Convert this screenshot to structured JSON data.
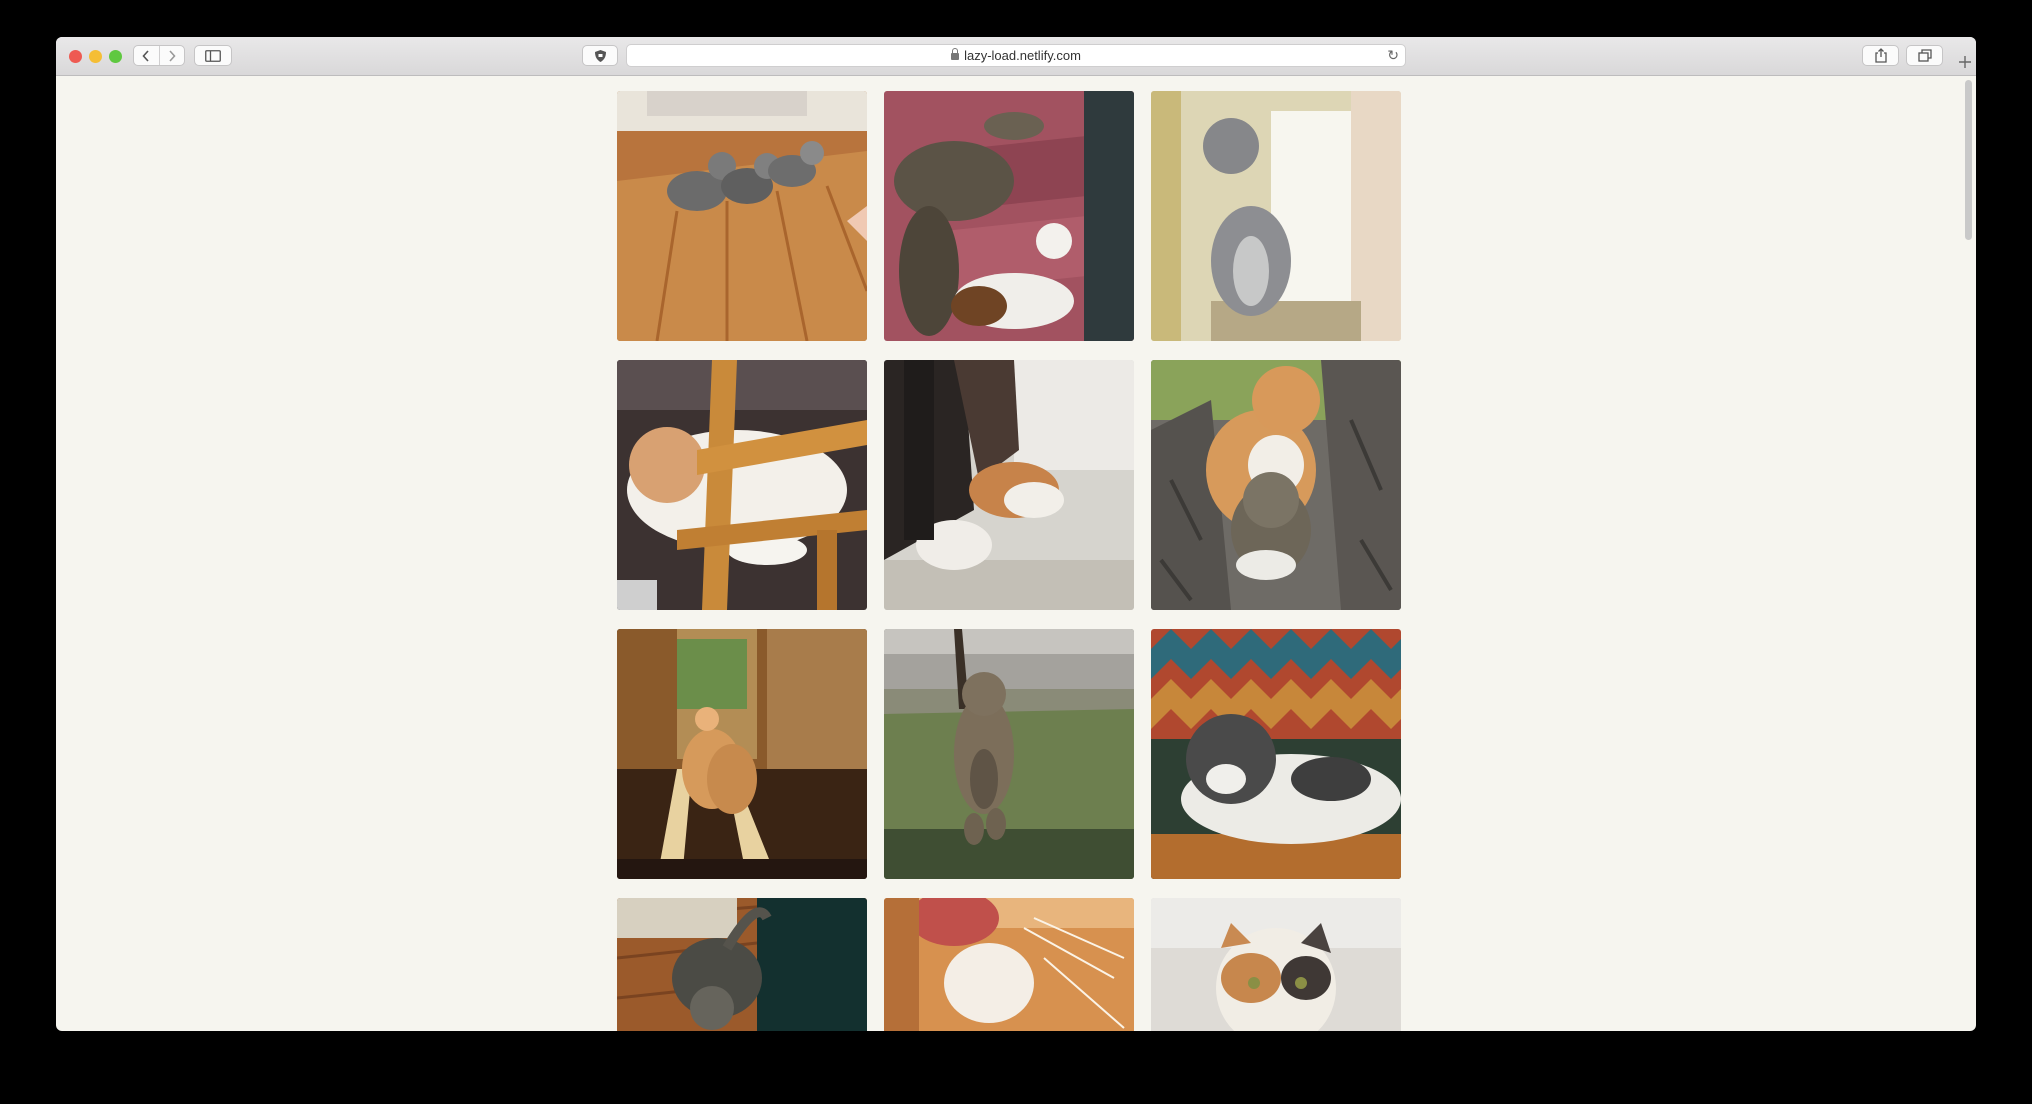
{
  "browser": {
    "url": "lazy-load.netlify.com",
    "back_icon": "chevron-left-icon",
    "forward_icon": "chevron-right-icon",
    "sidebar_icon": "sidebar-icon",
    "shield_icon": "shield-icon",
    "reload_icon": "reload-icon",
    "share_icon": "share-icon",
    "tabs_icon": "tabs-overview-icon",
    "new_tab_icon": "plus-icon"
  },
  "gallery": {
    "tiles": [
      {
        "name": "photo-kittens-on-floor"
      },
      {
        "name": "photo-cats-on-stairs"
      },
      {
        "name": "photo-cat-at-window"
      },
      {
        "name": "photo-cat-under-chair"
      },
      {
        "name": "photo-cat-paws"
      },
      {
        "name": "photo-cats-in-tree"
      },
      {
        "name": "photo-cats-in-sunlight"
      },
      {
        "name": "photo-cat-walking-grass"
      },
      {
        "name": "photo-cat-on-chair"
      },
      {
        "name": "photo-cat-on-wood-floor"
      },
      {
        "name": "photo-cat-licking-paw"
      },
      {
        "name": "photo-calico-cat"
      }
    ]
  }
}
